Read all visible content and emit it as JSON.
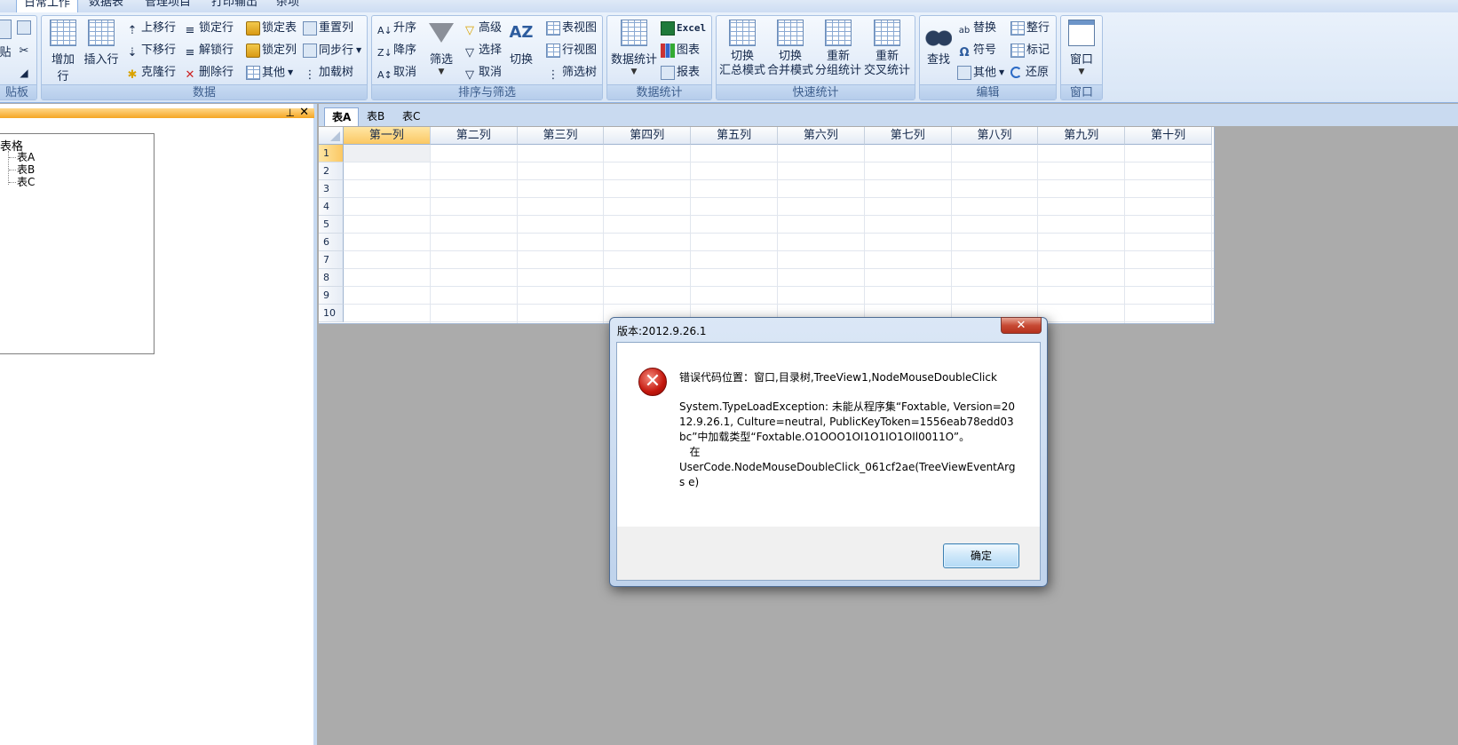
{
  "menu": {
    "tabs": [
      {
        "label": "日常工作",
        "active": true
      },
      {
        "label": "数据表",
        "active": false
      },
      {
        "label": "管理项目",
        "active": false
      },
      {
        "label": "打印输出",
        "active": false
      },
      {
        "label": "杂项",
        "active": false
      }
    ]
  },
  "ribbon": {
    "clipboard": {
      "label": "贴板",
      "paste": "贴"
    },
    "data": {
      "label": "数据",
      "add_row": "增加行",
      "insert_row": "插入行",
      "move_up": "上移行",
      "move_down": "下移行",
      "clone_row": "克隆行",
      "lock_row": "锁定行",
      "unlock_row": "解锁行",
      "delete_row": "删除行",
      "lock_table": "锁定表",
      "lock_column": "锁定列",
      "other": "其他",
      "reset_column": "重置列",
      "sync_step": "同步行",
      "load_tree": "加载树"
    },
    "sort_filter": {
      "label": "排序与筛选",
      "asc": "升序",
      "desc": "降序",
      "cancel": "取消",
      "filter": "筛选",
      "advanced": "高级",
      "select": "选择",
      "cancel2": "取消",
      "switch": "切换",
      "table_view": "表视图",
      "row_view": "行视图",
      "filter_tree": "筛选树"
    },
    "stats": {
      "label": "数据统计",
      "data_stats": "数据统计",
      "excel": "Excel",
      "chart": "图表",
      "report": "报表"
    },
    "quick_stats": {
      "label": "快速统计",
      "switch_summary_1": "切换",
      "switch_summary_2": "汇总模式",
      "switch_merge_1": "切换",
      "switch_merge_2": "合并模式",
      "regroup_1": "重新",
      "regroup_2": "分组统计",
      "recross_1": "重新",
      "recross_2": "交叉统计"
    },
    "edit": {
      "label": "编辑",
      "find": "查找",
      "replace": "替换",
      "symbol": "符号",
      "other": "其他",
      "arrange": "整行",
      "mark": "标记",
      "restore": "还原"
    },
    "window": {
      "label": "窗口",
      "window": "窗口"
    }
  },
  "tree": {
    "root": "表格",
    "children": [
      "表A",
      "表B",
      "表C"
    ]
  },
  "sheet_tabs": [
    {
      "label": "表A",
      "active": true
    },
    {
      "label": "表B",
      "active": false
    },
    {
      "label": "表C",
      "active": false
    }
  ],
  "grid": {
    "columns": [
      "第一列",
      "第二列",
      "第三列",
      "第四列",
      "第五列",
      "第六列",
      "第七列",
      "第八列",
      "第九列",
      "第十列"
    ],
    "rows": [
      "1",
      "2",
      "3",
      "4",
      "5",
      "6",
      "7",
      "8",
      "9",
      "10"
    ]
  },
  "dialog": {
    "title": "版本:2012.9.26.1",
    "close": "✕",
    "message_line1": "错误代码位置：窗口,目录树,TreeView1,NodeMouseDoubleClick",
    "message_detail": "System.TypeLoadException: 未能从程序集“Foxtable, Version=2012.9.26.1, Culture=neutral, PublicKeyToken=1556eab78edd03bc”中加载类型“Foxtable.O1OOO1OI1O1IO1OIl0011O”。\n   在\nUserCode.NodeMouseDoubleClick_061cf2ae(TreeViewEventArgs e)",
    "ok_label": "确定"
  },
  "colors": {
    "ribbon_bg": "#dbe7f6",
    "accent_orange": "#fbc863",
    "error_red": "#c4170d"
  }
}
